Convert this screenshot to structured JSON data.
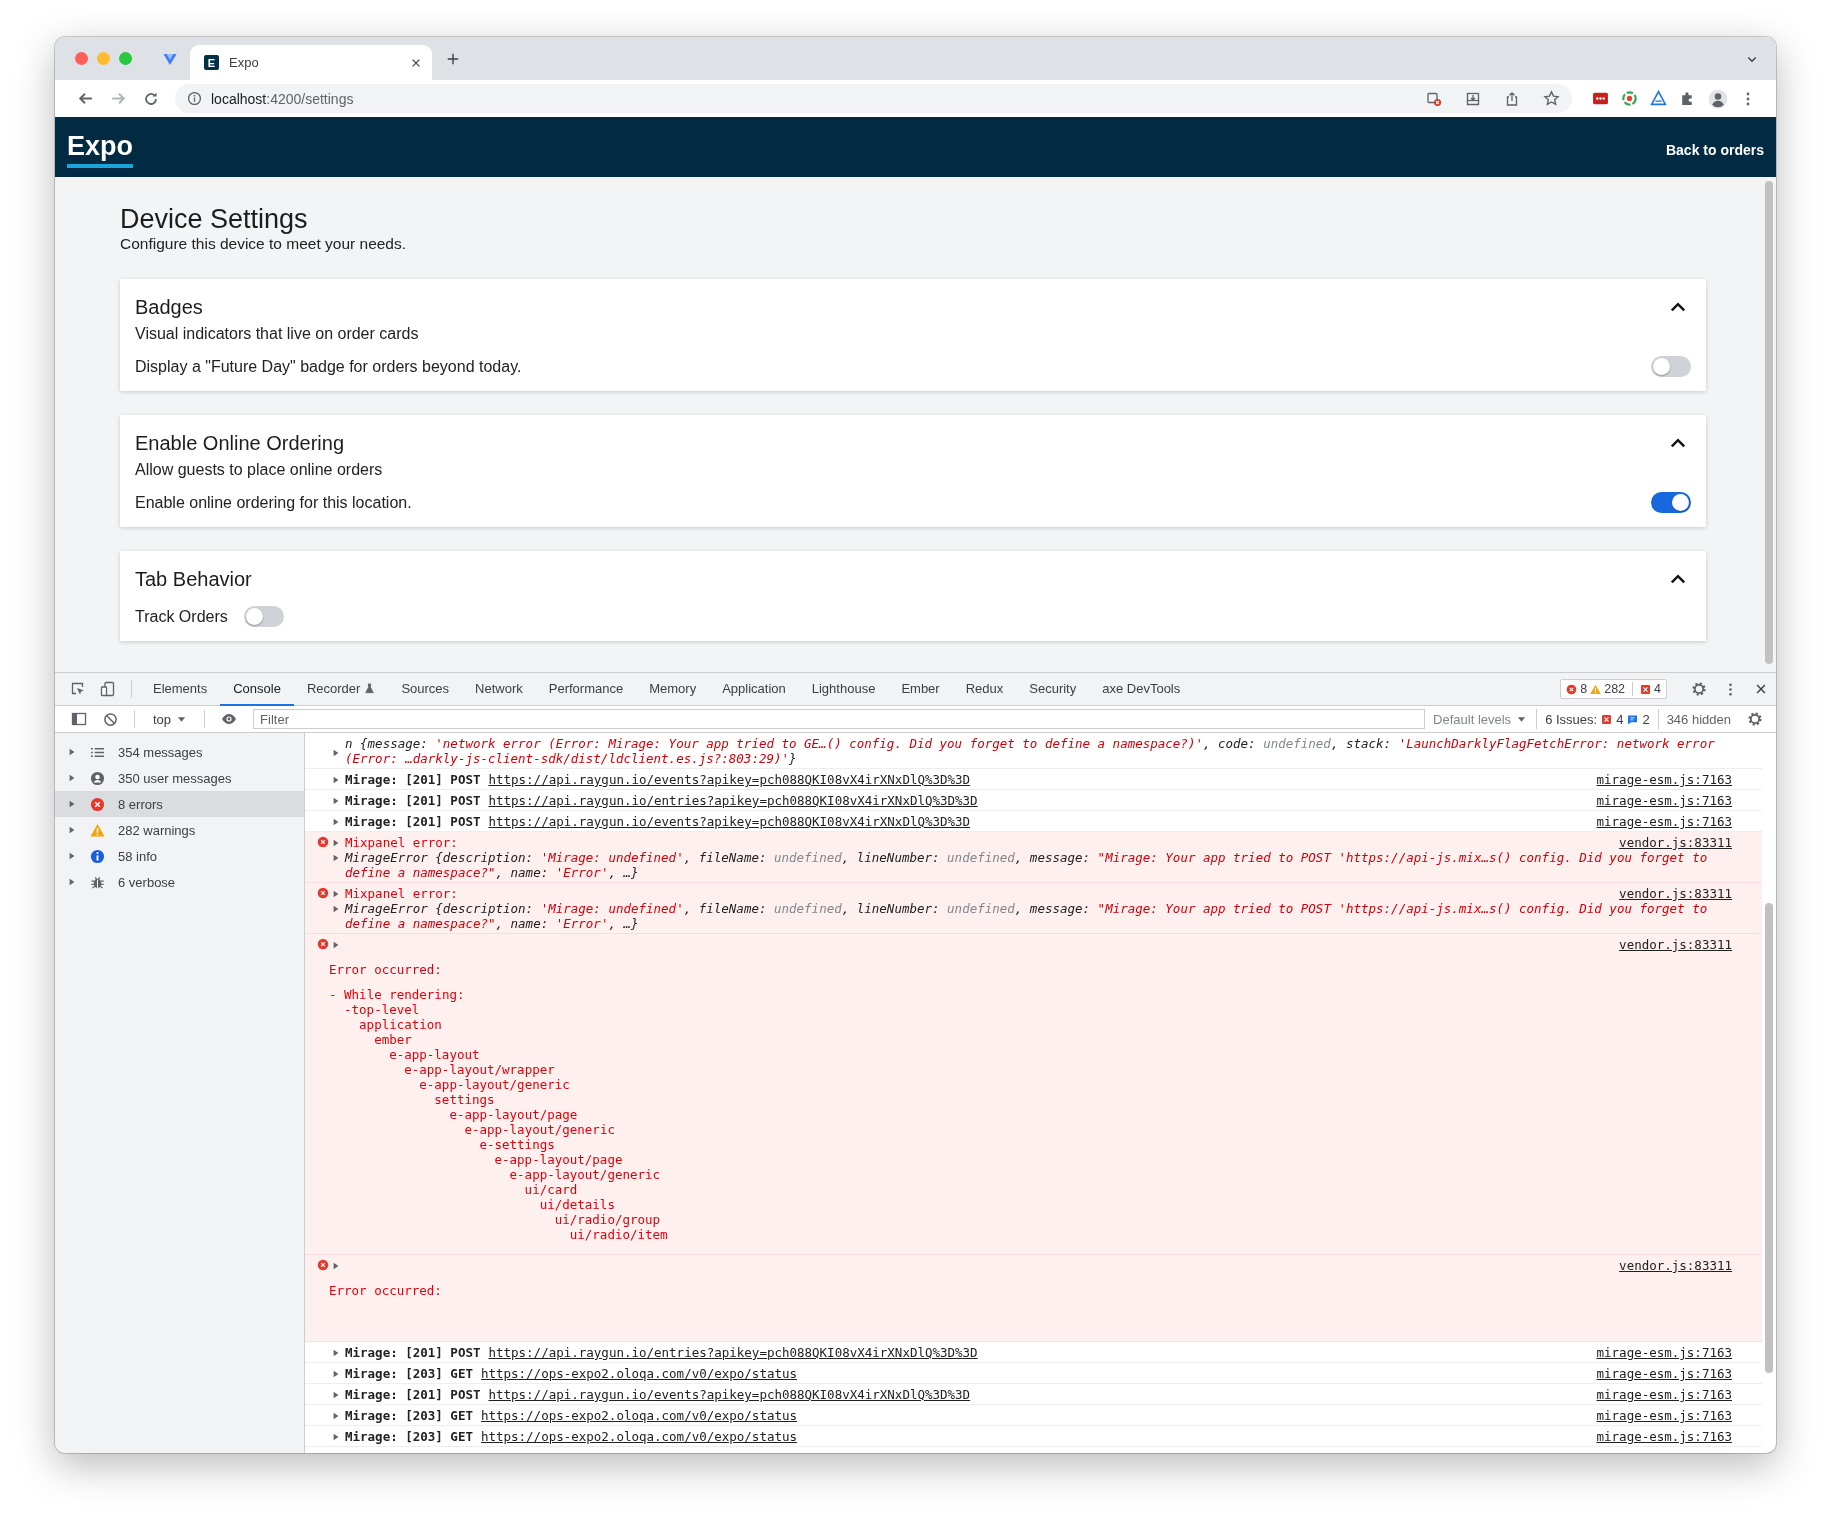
{
  "browser": {
    "tabs": [
      {
        "favicon": "E",
        "title": "Expo",
        "selected": true
      }
    ],
    "url_host": "localhost",
    "url_path": ":4200/settings"
  },
  "app_header": {
    "logo": "Expo",
    "link": "Back to orders"
  },
  "page": {
    "title": "Device Settings",
    "subtitle": "Configure this device to meet your needs.",
    "sections": [
      {
        "title": "Badges",
        "description": "Visual indicators that live on order cards",
        "expanded": true,
        "settings": [
          {
            "kind": "row",
            "label": "Display a \"Future Day\" badge for orders beyond today.",
            "on": false
          }
        ]
      },
      {
        "title": "Enable Online Ordering",
        "description": "Allow guests to place online orders",
        "expanded": true,
        "settings": [
          {
            "kind": "row",
            "label": "Enable online ordering for this location.",
            "on": true
          }
        ]
      },
      {
        "title": "Tab Behavior",
        "expanded": true,
        "settings": [
          {
            "kind": "inline",
            "label": "Track Orders",
            "on": false
          }
        ]
      }
    ]
  },
  "devtools": {
    "tabs": [
      {
        "label": "Elements",
        "selected": false,
        "experimental": false
      },
      {
        "label": "Console",
        "selected": true,
        "experimental": false
      },
      {
        "label": "Recorder",
        "selected": false,
        "experimental": true
      },
      {
        "label": "Sources",
        "selected": false,
        "experimental": false
      },
      {
        "label": "Network",
        "selected": false,
        "experimental": false
      },
      {
        "label": "Performance",
        "selected": false,
        "experimental": false
      },
      {
        "label": "Memory",
        "selected": false,
        "experimental": false
      },
      {
        "label": "Application",
        "selected": false,
        "experimental": false
      },
      {
        "label": "Lighthouse",
        "selected": false,
        "experimental": false
      },
      {
        "label": "Ember",
        "selected": false,
        "experimental": false
      },
      {
        "label": "Redux",
        "selected": false,
        "experimental": false
      },
      {
        "label": "Security",
        "selected": false,
        "experimental": false
      },
      {
        "label": "axe DevTools",
        "selected": false,
        "experimental": false
      }
    ],
    "error_count": "8",
    "warning_count": "282",
    "issue_count": "4",
    "toolbar": {
      "context": "top",
      "placeholder": "Filter",
      "levels": "Default levels",
      "issues_label": "6 Issues:",
      "issues_errors": "4",
      "issues_info": "2",
      "hidden": "346 hidden"
    },
    "sidebar": [
      {
        "kind": "messages",
        "label": "354 messages",
        "selected": false
      },
      {
        "kind": "user",
        "label": "350 user messages",
        "selected": false
      },
      {
        "kind": "error",
        "label": "8 errors",
        "selected": true
      },
      {
        "kind": "warning",
        "label": "282 warnings",
        "selected": false
      },
      {
        "kind": "info",
        "label": "58 info",
        "selected": false
      },
      {
        "kind": "verbose",
        "label": "6 verbose",
        "selected": false
      }
    ],
    "messages": [
      {
        "kind": "object",
        "parts": [
          {
            "text": "n {message: ",
            "kind": "key"
          },
          {
            "text": "'network error (Error: Mirage: Your app tried to GE…() config. Did you forget to define a namespace?)'",
            "kind": "string"
          },
          {
            "text": ", code: ",
            "kind": "key"
          },
          {
            "text": "undefined",
            "kind": "undef"
          },
          {
            "text": ", stack: ",
            "kind": "key"
          },
          {
            "text": "'LaunchDarklyFlagFetchError: network error (Error: …darkly-js-client-sdk/dist/ldclient.es.js?:803:29)'",
            "kind": "string"
          },
          {
            "text": "}",
            "kind": "key"
          }
        ]
      },
      {
        "kind": "log",
        "method": "Mirage: [201] POST",
        "url": "https://api.raygun.io/events?apikey=pch088QKI08vX4irXNxDlQ%3D%3D",
        "source": "mirage-esm.js:7163"
      },
      {
        "kind": "log",
        "method": "Mirage: [201] POST",
        "url": "https://api.raygun.io/entries?apikey=pch088QKI08vX4irXNxDlQ%3D%3D",
        "source": "mirage-esm.js:7163"
      },
      {
        "kind": "log",
        "method": "Mirage: [201] POST",
        "url": "https://api.raygun.io/events?apikey=pch088QKI08vX4irXNxDlQ%3D%3D",
        "source": "mirage-esm.js:7163"
      },
      {
        "kind": "error",
        "title": "Mixpanel error:",
        "source": "vendor.js:83311",
        "parts": [
          {
            "text": "MirageError {description: ",
            "kind": "key"
          },
          {
            "text": "'Mirage: undefined'",
            "kind": "string"
          },
          {
            "text": ", fileName: ",
            "kind": "key"
          },
          {
            "text": "undefined",
            "kind": "undef"
          },
          {
            "text": ", lineNumber: ",
            "kind": "key"
          },
          {
            "text": "undefined",
            "kind": "undef"
          },
          {
            "text": ", message: ",
            "kind": "key"
          },
          {
            "text": "\"Mirage: Your app tried to POST 'https://api-js.mix…s() config. Did you forget to define a namespace?\"",
            "kind": "string"
          },
          {
            "text": ", name: ",
            "kind": "key"
          },
          {
            "text": "'Error'",
            "kind": "string"
          },
          {
            "text": ", …}",
            "kind": "key"
          }
        ]
      },
      {
        "kind": "error",
        "title": "Mixpanel error:",
        "source": "vendor.js:83311",
        "parts": [
          {
            "text": "MirageError {description: ",
            "kind": "key"
          },
          {
            "text": "'Mirage: undefined'",
            "kind": "string"
          },
          {
            "text": ", fileName: ",
            "kind": "key"
          },
          {
            "text": "undefined",
            "kind": "undef"
          },
          {
            "text": ", lineNumber: ",
            "kind": "key"
          },
          {
            "text": "undefined",
            "kind": "undef"
          },
          {
            "text": ", message: ",
            "kind": "key"
          },
          {
            "text": "\"Mirage: Your app tried to POST 'https://api-js.mix…s() config. Did you forget to define a namespace?\"",
            "kind": "string"
          },
          {
            "text": ", name: ",
            "kind": "key"
          },
          {
            "text": "'Error'",
            "kind": "string"
          },
          {
            "text": ", …}",
            "kind": "key"
          }
        ]
      },
      {
        "kind": "trace",
        "source": "vendor.js:83311",
        "heading": "Error occurred:",
        "subheading": "- While rendering:",
        "tree": {
          "label": "-top-level",
          "children": [
            {
              "label": "application",
              "children": [
                {
                  "label": "ember",
                  "children": [
                    {
                      "label": "e-app-layout",
                      "children": [
                        {
                          "label": "e-app-layout/wrapper",
                          "children": [
                            {
                              "label": "e-app-layout/generic",
                              "children": [
                                {
                                  "label": "settings",
                                  "children": [
                                    {
                                      "label": "e-app-layout/page",
                                      "children": [
                                        {
                                          "label": "e-app-layout/generic",
                                          "children": [
                                            {
                                              "label": "e-settings",
                                              "children": [
                                                {
                                                  "label": "e-app-layout/page",
                                                  "children": [
                                                    {
                                                      "label": "e-app-layout/generic",
                                                      "children": [
                                                        {
                                                          "label": "ui/card",
                                                          "children": [
                                                            {
                                                              "label": "ui/details",
                                                              "children": [
                                                                {
                                                                  "label": "ui/radio/group",
                                                                  "children": [
                                                                    {
                                                                      "label": "ui/radio/item"
                                                                    }
                                                                  ]
                                                                }
                                                              ]
                                                            }
                                                          ]
                                                        }
                                                      ]
                                                    }
                                                  ]
                                                }
                                              ]
                                            }
                                          ]
                                        }
                                      ]
                                    }
                                  ]
                                }
                              ]
                            }
                          ]
                        }
                      ]
                    }
                  ]
                }
              ]
            }
          ]
        }
      },
      {
        "kind": "trace",
        "source": "vendor.js:83311",
        "heading": "Error occurred:"
      },
      {
        "kind": "log",
        "method": "Mirage: [201] POST",
        "url": "https://api.raygun.io/entries?apikey=pch088QKI08vX4irXNxDlQ%3D%3D",
        "source": "mirage-esm.js:7163"
      },
      {
        "kind": "log",
        "method": "Mirage: [203] GET",
        "url": "https://ops-expo2.oloqa.com/v0/expo/status",
        "source": "mirage-esm.js:7163"
      },
      {
        "kind": "log",
        "method": "Mirage: [201] POST",
        "url": "https://api.raygun.io/events?apikey=pch088QKI08vX4irXNxDlQ%3D%3D",
        "source": "mirage-esm.js:7163"
      },
      {
        "kind": "log",
        "method": "Mirage: [203] GET",
        "url": "https://ops-expo2.oloqa.com/v0/expo/status",
        "source": "mirage-esm.js:7163"
      },
      {
        "kind": "log",
        "method": "Mirage: [203] GET",
        "url": "https://ops-expo2.oloqa.com/v0/expo/status",
        "source": "mirage-esm.js:7163"
      }
    ]
  }
}
